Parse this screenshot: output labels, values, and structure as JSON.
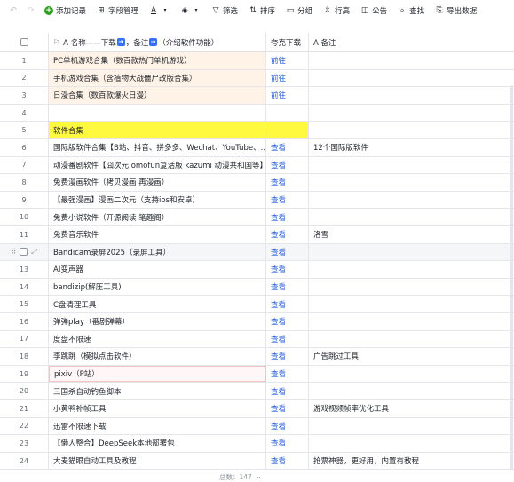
{
  "toolbar": {
    "undo_icon": "undo-icon",
    "redo_icon": "redo-icon",
    "add_record": "添加记录",
    "field_manage": "字段管理",
    "filter": "筛选",
    "sort": "排序",
    "group": "分组",
    "row_height": "行高",
    "announcement": "公告",
    "search": "查找",
    "export": "导出数据"
  },
  "header": {
    "col_name": "A 名称——下载",
    "col_name_mid": "，备注",
    "col_name_tail": "（介绍软件功能）",
    "col_download": "夸克下载",
    "col_note": "A 备注"
  },
  "rows": [
    {
      "num": "1",
      "name": "PC单机游戏合集（数百款热门单机游戏）",
      "dl": "前往",
      "note": "",
      "style": "peach"
    },
    {
      "num": "2",
      "name": "手机游戏合集（含植物大战僵尸改版合集）",
      "dl": "前往",
      "note": "",
      "style": "peach"
    },
    {
      "num": "3",
      "name": "日漫合集（数百款爆火日漫）",
      "dl": "前往",
      "note": "",
      "style": "peach"
    },
    {
      "num": "4",
      "name": "",
      "dl": "",
      "note": "",
      "style": ""
    },
    {
      "num": "5",
      "name": "软件合集",
      "dl": "",
      "note": "",
      "style": "yellow"
    },
    {
      "num": "6",
      "name": "国际版软件合集【B站、抖音、拼多多、Wechat、YouTube、...",
      "dl": "查看",
      "note": "12个国际版软件",
      "style": ""
    },
    {
      "num": "7",
      "name": "动漫番剧软件【囧次元 omofun复活版 kazumi 动漫共和国等】",
      "dl": "查看",
      "note": "",
      "style": ""
    },
    {
      "num": "8",
      "name": "免费漫画软件（拷贝漫画 再漫画）",
      "dl": "查看",
      "note": "",
      "style": ""
    },
    {
      "num": "9",
      "name": "【最强漫画】漫画二次元（支持ios和安卓）",
      "dl": "查看",
      "note": "",
      "style": ""
    },
    {
      "num": "10",
      "name": "免费小说软件（开源阅读 笔趣阁）",
      "dl": "查看",
      "note": "",
      "style": ""
    },
    {
      "num": "11",
      "name": "免费音乐软件",
      "dl": "查看",
      "note": "洛雪",
      "style": ""
    },
    {
      "num": "12",
      "name": "Bandicam录屏2025（录屏工具）",
      "dl": "查看",
      "note": "",
      "style": "hover"
    },
    {
      "num": "13",
      "name": " AI变声器",
      "dl": "查看",
      "note": "",
      "style": ""
    },
    {
      "num": "14",
      "name": "bandizip(解压工具)",
      "dl": "查看",
      "note": "",
      "style": ""
    },
    {
      "num": "15",
      "name": "C盘清理工具",
      "dl": "查看",
      "note": "",
      "style": ""
    },
    {
      "num": "16",
      "name": "弹弹play（番剧弹幕）",
      "dl": "查看",
      "note": "",
      "style": ""
    },
    {
      "num": "17",
      "name": "度盘不限速",
      "dl": "查看",
      "note": "",
      "style": ""
    },
    {
      "num": "18",
      "name": "李跳跳（模拟点击软件）",
      "dl": "查看",
      "note": "广告跳过工具",
      "style": ""
    },
    {
      "num": "19",
      "name": "pixiv（P站）",
      "dl": "查看",
      "note": "",
      "style": "sel"
    },
    {
      "num": "20",
      "name": "三国杀自动钓鱼脚本",
      "dl": "查看",
      "note": "",
      "style": ""
    },
    {
      "num": "21",
      "name": "小黄鸭补帧工具",
      "dl": "查看",
      "note": "游戏视频帧率优化工具",
      "style": ""
    },
    {
      "num": "22",
      "name": "迅雷不限速下载",
      "dl": "查看",
      "note": "",
      "style": ""
    },
    {
      "num": "23",
      "name": "【懒人整合】DeepSeek本地部署包",
      "dl": "查看",
      "note": "",
      "style": ""
    },
    {
      "num": "24",
      "name": "大麦猫眼自动工具及教程",
      "dl": "查看",
      "note": "抢票神器，更好用，内置有教程",
      "style": ""
    }
  ],
  "footer": {
    "total": "总数：147"
  },
  "colors": {
    "link": "#245bdb",
    "accent": "#3370ff",
    "peach": "#fff2e6",
    "yellow": "#fff93f",
    "green": "#2ea121"
  }
}
